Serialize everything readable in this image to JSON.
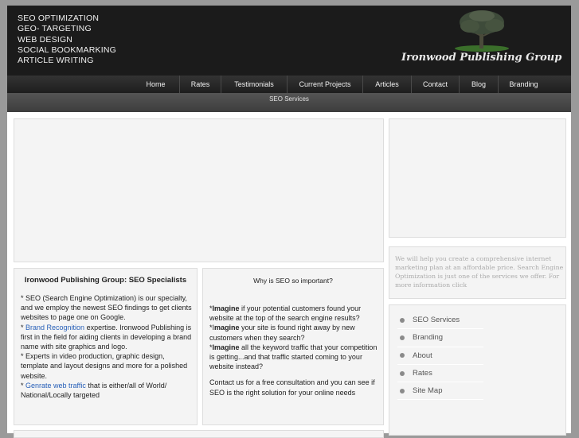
{
  "header": {
    "services": [
      "SEO OPTIMIZATION",
      "GEO- TARGETING",
      "WEB DESIGN",
      "SOCIAL BOOKMARKING",
      "ARTICLE WRITING"
    ],
    "logo_text": "Ironwood Publishing Group"
  },
  "nav": {
    "items": [
      "Home",
      "Rates",
      "Testimonials",
      "Current Projects",
      "Articles",
      "Contact",
      "Blog",
      "Branding"
    ]
  },
  "subnav": {
    "label": "SEO Services"
  },
  "specialists": {
    "title": "Ironwood Publishing Group: SEO Specialists",
    "line1": "* SEO (Search Engine Optimization) is our specialty, and we employ the newest SEO findings to get clients websites to page one on Google.",
    "line2_prefix": " * ",
    "line2_link": "Brand Recognition",
    "line2_rest": " expertise. Ironwood Publishing is first in the field for aiding clients in developing a brand name with site graphics and logo.",
    "line3": "* Experts in video production, graphic design, template and layout designs and more for a polished website.",
    "line4_prefix": "*  ",
    "line4_link": "Genrate web traffic",
    "line4_rest": " that is either/all of World/ National/Locally targeted"
  },
  "why": {
    "title": "Why is SEO so important?",
    "p1_bold": "Imagine",
    "p1_rest": " if your potential customers found your website at the top of the search engine results?",
    "p2_lead": "*I",
    "p2_bold": "magine",
    "p2_rest": " your site is found right away by new customers when they search?",
    "p3_bold": "Imagine",
    "p3_rest": " all the keyword traffic that your competition is getting...and that traffic started coming to your website instead?",
    "p4": "Contact us for a free consultation and you can see if SEO is the right solution for your online needs"
  },
  "sidebar": {
    "intro": "We will help you create a comprehensive internet marketing plan at an affordable price. Search Engine Optimization is just one of the services we offer. For more information click",
    "menu": [
      "SEO Services",
      "Branding",
      "About",
      "Rates",
      "Site Map"
    ]
  }
}
